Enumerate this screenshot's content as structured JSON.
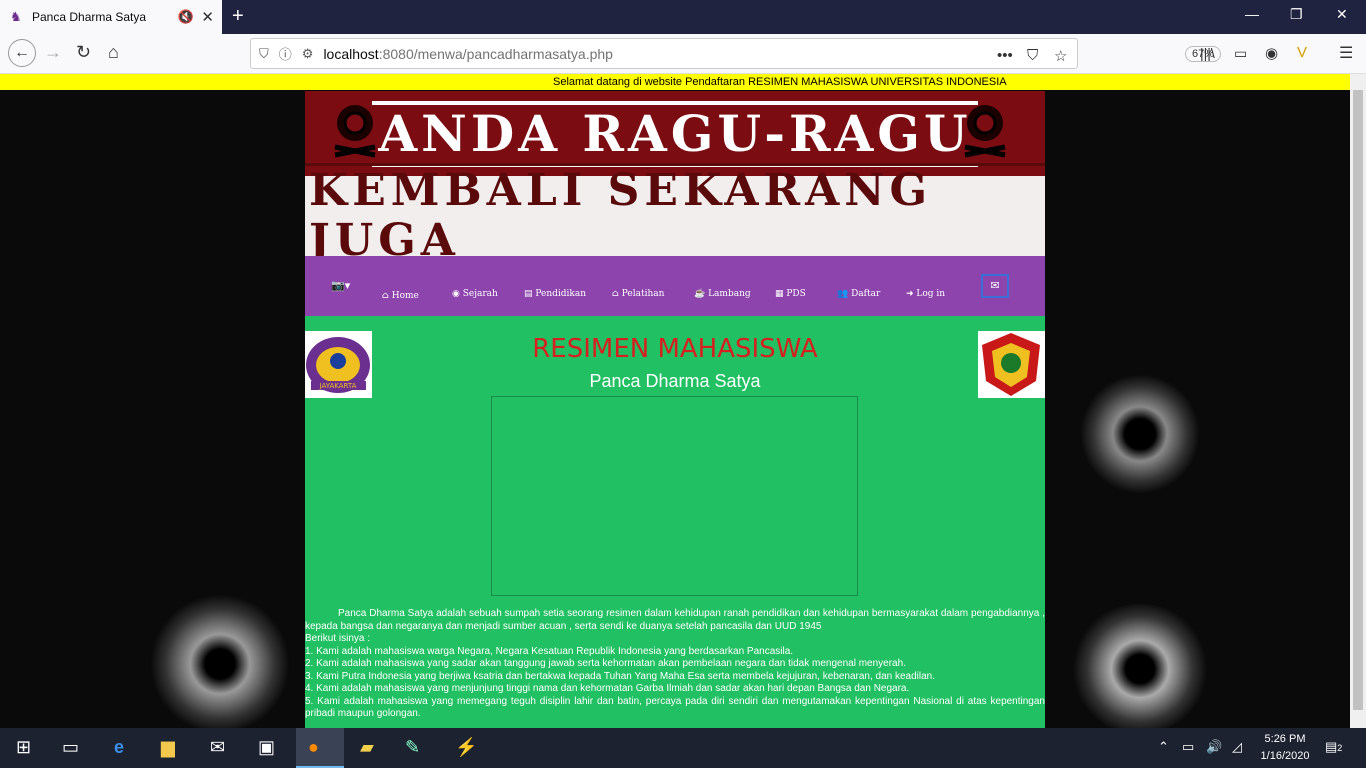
{
  "browser": {
    "tab_title": "Panca Dharma Satya",
    "url_host": "localhost",
    "url_path": ":8080/menwa/pancadharmasatya.php",
    "zoom": "67%"
  },
  "page": {
    "marquee": "Selamat datang di website Pendaftaran RESIMEN MAHASISWA UNIVERSITAS INDONESIA",
    "banner_top": "ANDA RAGU-RAGU",
    "banner_bottom": "KEMBALI SEKARANG JUGA",
    "menu": [
      {
        "icon": "home-icon",
        "label": "Home"
      },
      {
        "icon": "globe-icon",
        "label": "Sejarah"
      },
      {
        "icon": "book-icon",
        "label": "Pendidikan"
      },
      {
        "icon": "graduation-cap-icon",
        "label": "Pelatihan"
      },
      {
        "icon": "coffee-icon",
        "label": "Lambang"
      },
      {
        "icon": "map-icon",
        "label": "PDS"
      },
      {
        "icon": "users-icon",
        "label": "Daftar"
      },
      {
        "icon": "sign-in-icon",
        "label": "Log in"
      }
    ],
    "heading": "RESIMEN MAHASISWA",
    "subheading": "Panca Dharma Satya",
    "intro": "Panca Dharma Satya adalah sebuah sumpah setia seorang resimen dalam kehidupan ranah pendidikan dan kehidupan bermasyarakat dalam pengabdiannya , kepada bangsa dan negaranya dan menjadi sumber acuan , serta sendi ke duanya setelah pancasila dan UUD 1945",
    "list_intro": "Berikut isinya :",
    "items": [
      "1. Kami adalah mahasiswa warga Negara, Negara Kesatuan Republik Indonesia yang berdasarkan Pancasila.",
      "2. Kami adalah mahasiswa yang sadar akan tanggung jawab serta kehormatan akan pembelaan negara dan tidak mengenal menyerah.",
      "3. Kami Putra Indonesia yang berjiwa ksatria dan bertakwa kepada Tuhan Yang Maha Esa serta membela kejujuran, kebenaran, dan keadilan.",
      "4. Kami adalah mahasiswa yang menjunjung tinggi nama dan kehormatan Garba Ilmiah dan sadar akan hari depan Bangsa dan Negara.",
      "5. Kami adalah mahasiswa yang memegang teguh disiplin lahir dan batin, percaya pada diri sendiri dan mengutamakan kepentingan Nasional di atas kepentingan pribadi maupun golongan."
    ],
    "left_logo_text": "JAYAKARTA"
  },
  "taskbar": {
    "time": "5:26 PM",
    "date": "1/16/2020",
    "notifications": "2"
  },
  "colors": {
    "accent_green": "#21c063",
    "menu_purple": "#8e44ad",
    "banner_red": "#7a0c12",
    "marquee_yellow": "#ffff00"
  }
}
